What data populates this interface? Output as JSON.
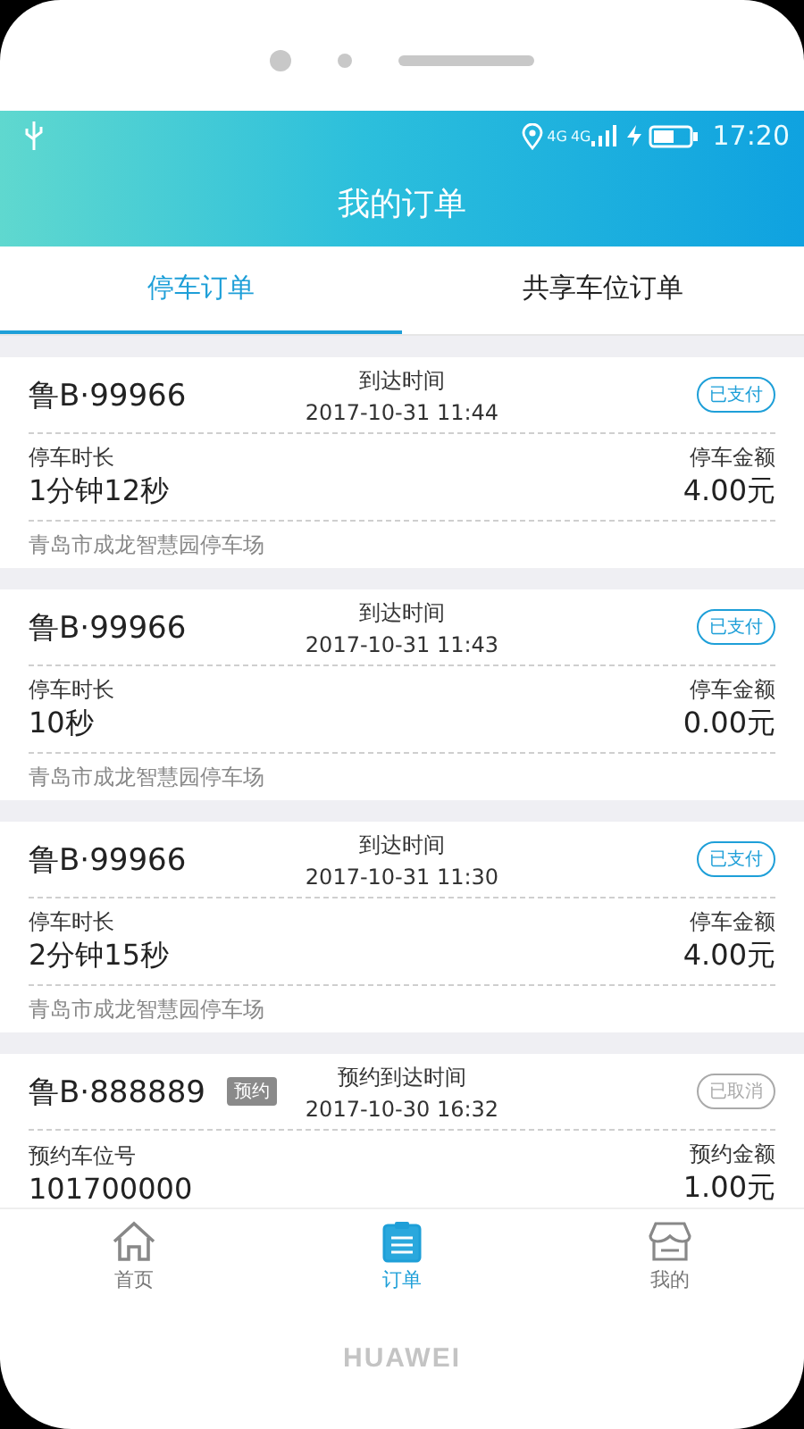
{
  "status_bar": {
    "network_labels": [
      "4G",
      "4G"
    ],
    "time": "17:20"
  },
  "header": {
    "title": "我的订单"
  },
  "tabs": [
    {
      "label": "停车订单",
      "selected": true
    },
    {
      "label": "共享车位订单",
      "selected": false
    }
  ],
  "orders": [
    {
      "plate": "鲁B·99966",
      "time_label": "到达时间",
      "time": "2017-10-31 11:44",
      "status": {
        "label": "已支付",
        "kind": "paid"
      },
      "left_label": "停车时长",
      "left_value": "1分钟12秒",
      "right_label": "停车金额",
      "right_value": "4.00元",
      "location": "青岛市成龙智慧园停车场"
    },
    {
      "plate": "鲁B·99966",
      "time_label": "到达时间",
      "time": "2017-10-31 11:43",
      "status": {
        "label": "已支付",
        "kind": "paid"
      },
      "left_label": "停车时长",
      "left_value": "10秒",
      "right_label": "停车金额",
      "right_value": "0.00元",
      "location": "青岛市成龙智慧园停车场"
    },
    {
      "plate": "鲁B·99966",
      "time_label": "到达时间",
      "time": "2017-10-31 11:30",
      "status": {
        "label": "已支付",
        "kind": "paid"
      },
      "left_label": "停车时长",
      "left_value": "2分钟15秒",
      "right_label": "停车金额",
      "right_value": "4.00元",
      "location": "青岛市成龙智慧园停车场"
    },
    {
      "plate": "鲁B·888889",
      "tag": "预约",
      "time_label": "预约到达时间",
      "time": "2017-10-30 16:32",
      "status": {
        "label": "已取消",
        "kind": "cancelled"
      },
      "left_label": "预约车位号",
      "left_value": "101700000",
      "right_label": "预约金额",
      "right_value": "1.00元"
    }
  ],
  "bottom_nav": [
    {
      "label": "首页",
      "kind": "home",
      "selected": false
    },
    {
      "label": "订单",
      "kind": "orders",
      "selected": true
    },
    {
      "label": "我的",
      "kind": "shop",
      "selected": false
    }
  ],
  "brand": "HUAWEI"
}
